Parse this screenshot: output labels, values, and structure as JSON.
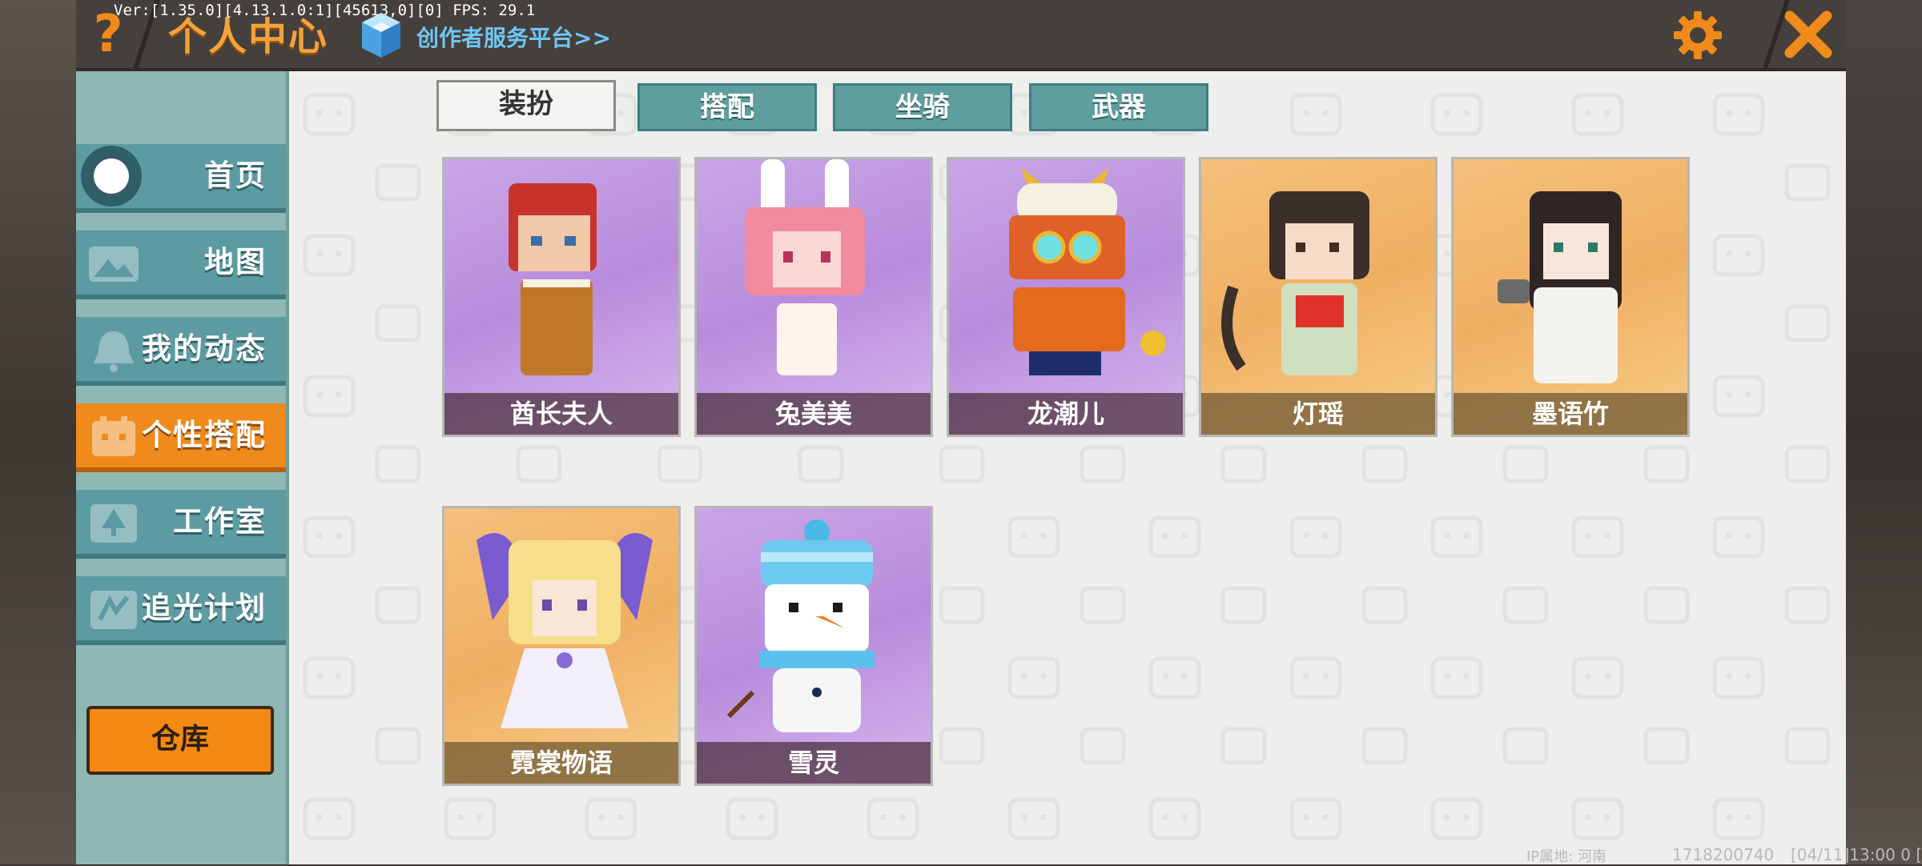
{
  "app": {
    "title": "个人中心",
    "version": "Ver:[1.35.0][4.13.1.0:1][45613,0][0] FPS: 29.1",
    "creator_link": "创作者服务平台>>",
    "help_label": "?"
  },
  "sidebar": {
    "items": [
      {
        "label": "首页",
        "icon": "home-dot-icon",
        "active": false
      },
      {
        "label": "地图",
        "icon": "map-icon",
        "active": false
      },
      {
        "label": "我的动态",
        "icon": "bell-icon",
        "active": false
      },
      {
        "label": "个性搭配",
        "icon": "outfit-icon",
        "active": true
      },
      {
        "label": "工作室",
        "icon": "tree-icon",
        "active": false
      },
      {
        "label": "追光计划",
        "icon": "chase-icon",
        "active": false
      }
    ],
    "warehouse_label": "仓库"
  },
  "tabs": [
    {
      "label": "装扮",
      "active": true
    },
    {
      "label": "搭配",
      "active": false
    },
    {
      "label": "坐骑",
      "active": false
    },
    {
      "label": "武器",
      "active": false
    }
  ],
  "skins": [
    {
      "name": "酋长夫人",
      "rarity_bg": "purple"
    },
    {
      "name": "兔美美",
      "rarity_bg": "purple"
    },
    {
      "name": "龙潮儿",
      "rarity_bg": "purple"
    },
    {
      "name": "灯瑶",
      "rarity_bg": "gold"
    },
    {
      "name": "墨语竹",
      "rarity_bg": "gold"
    },
    {
      "name": "霓裳物语",
      "rarity_bg": "gold"
    },
    {
      "name": "雪灵",
      "rarity_bg": "purple"
    }
  ],
  "footer": {
    "ip": "IP属地: 河南",
    "uid": "1718200740",
    "date": "[04/11]13:00 0 ["
  },
  "colors": {
    "accent_orange": "#f08a1a",
    "teal_nav": "#5d9ba3",
    "content_bg": "#eeeeec"
  }
}
